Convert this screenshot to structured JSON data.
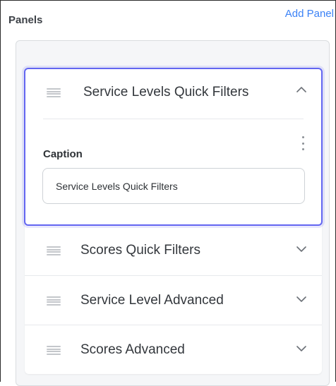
{
  "header": {
    "title": "Panels",
    "add_panel_label": "Add Panel"
  },
  "panels": [
    {
      "title": "Service Levels Quick Filters",
      "expanded": true,
      "caption_label": "Caption",
      "caption_value": "Service Levels Quick Filters"
    },
    {
      "title": "Scores Quick Filters",
      "expanded": false
    },
    {
      "title": "Service Level Advanced",
      "expanded": false
    },
    {
      "title": "Scores Advanced",
      "expanded": false
    }
  ],
  "icons": {
    "drag": "drag-handle-icon",
    "chevron_up": "chevron-up-icon",
    "chevron_down": "chevron-down-icon",
    "more": "kebab-menu-icon"
  },
  "colors": {
    "accent": "#6366f1",
    "link": "#3b82f6",
    "container_bg": "#f5f6f8"
  }
}
